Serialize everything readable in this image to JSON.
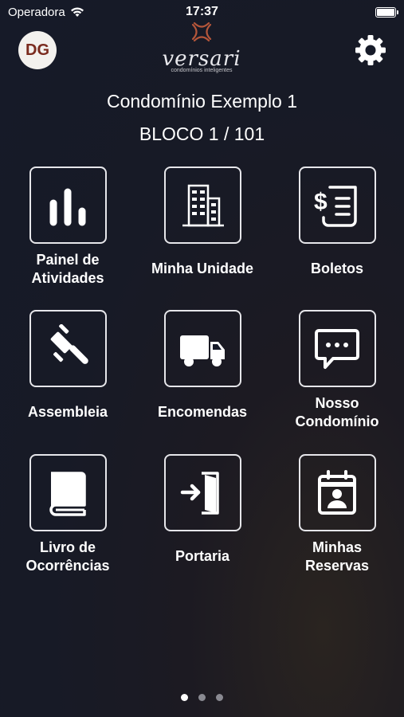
{
  "status_bar": {
    "carrier": "Operadora",
    "time": "17:37"
  },
  "header": {
    "avatar_initials": "DG",
    "logo_name": "versari",
    "logo_tagline": "condomínios inteligentes",
    "settings_icon": "gear-icon"
  },
  "condo": {
    "name": "Condomínio Exemplo 1",
    "unit": "BLOCO 1 / 101"
  },
  "menu": [
    {
      "label": "Painel de\nAtividades",
      "icon": "bar-chart-icon"
    },
    {
      "label": "Minha Unidade",
      "icon": "building-icon"
    },
    {
      "label": "Boletos",
      "icon": "invoice-icon"
    },
    {
      "label": "Assembleia",
      "icon": "gavel-icon"
    },
    {
      "label": "Encomendas",
      "icon": "truck-icon"
    },
    {
      "label": "Nosso\nCondomínio",
      "icon": "chat-icon"
    },
    {
      "label": "Livro de\nOcorrências",
      "icon": "book-icon"
    },
    {
      "label": "Portaria",
      "icon": "door-enter-icon"
    },
    {
      "label": "Minhas\nReservas",
      "icon": "calendar-person-icon"
    }
  ],
  "pager": {
    "pages": 3,
    "current": 1
  },
  "colors": {
    "background": "#171a26",
    "accent": "#b5563a",
    "foreground": "#ffffff"
  }
}
